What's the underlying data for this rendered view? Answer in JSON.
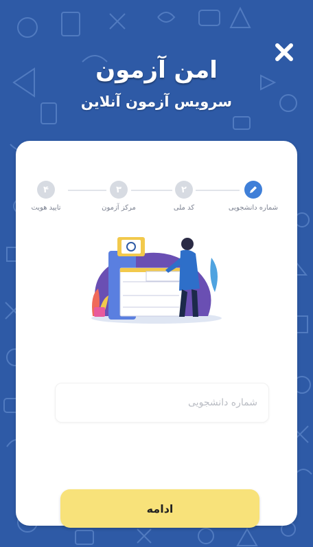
{
  "header": {
    "title": "امن آزمون",
    "subtitle": "سرویس آزمون آنلاین"
  },
  "stepper": {
    "steps": [
      {
        "label": "شماره دانشجویی",
        "number": "",
        "state": "active",
        "icon": "pencil-icon"
      },
      {
        "label": "کد ملی",
        "number": "۲",
        "state": "inactive"
      },
      {
        "label": "مرکز آزمون",
        "number": "۳",
        "state": "inactive"
      },
      {
        "label": "تایید هویت",
        "number": "۴",
        "state": "inactive"
      }
    ]
  },
  "form": {
    "student_id_placeholder": "شماره دانشجویی",
    "student_id_value": ""
  },
  "actions": {
    "continue_label": "ادامه"
  },
  "icons": {
    "close": "close-icon"
  },
  "colors": {
    "background": "#2e5aa6",
    "card": "#ffffff",
    "active_step": "#3f7fd8",
    "inactive_step": "#d7dbe2",
    "button": "#f8e27a"
  }
}
